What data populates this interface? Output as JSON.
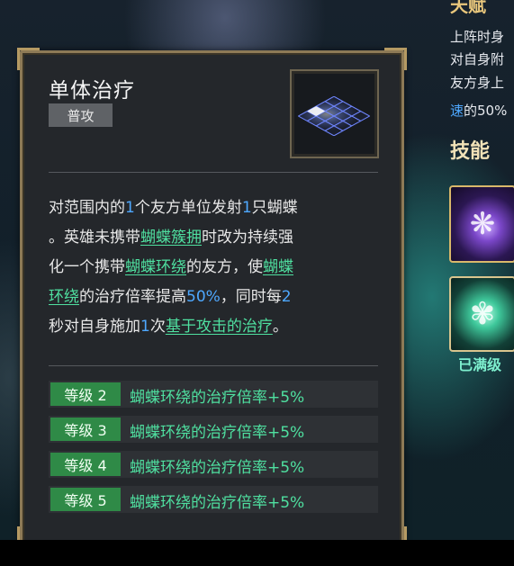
{
  "skill": {
    "name": "单体治疗",
    "tag": "普攻",
    "icon": "grid-tile-icon",
    "description": [
      [
        {
          "t": "对范围内的",
          "c": "text"
        },
        {
          "t": "1",
          "c": "num"
        },
        {
          "t": "个友方单位发射",
          "c": "text"
        },
        {
          "t": "1",
          "c": "num"
        },
        {
          "t": "只蝴蝶",
          "c": "text"
        }
      ],
      [
        {
          "t": "。英雄未携带",
          "c": "text"
        },
        {
          "t": "蝴蝶簇拥",
          "c": "link"
        },
        {
          "t": "时改为持续强",
          "c": "text"
        }
      ],
      [
        {
          "t": "化一个携带",
          "c": "text"
        },
        {
          "t": "蝴蝶环绕",
          "c": "link"
        },
        {
          "t": "的友方，使",
          "c": "text"
        },
        {
          "t": "蝴蝶",
          "c": "link"
        }
      ],
      [
        {
          "t": "环绕",
          "c": "link"
        },
        {
          "t": "的治疗倍率提高",
          "c": "text"
        },
        {
          "t": "50%",
          "c": "num"
        },
        {
          "t": "，同时每",
          "c": "text"
        },
        {
          "t": "2",
          "c": "num"
        }
      ],
      [
        {
          "t": "秒对自身施加",
          "c": "text"
        },
        {
          "t": "1",
          "c": "num"
        },
        {
          "t": "次",
          "c": "text"
        },
        {
          "t": "基于攻击的治疗",
          "c": "link"
        },
        {
          "t": "。",
          "c": "text"
        }
      ]
    ],
    "levels": [
      {
        "label": "等级 2",
        "effect": "蝴蝶环绕的治疗倍率+5%"
      },
      {
        "label": "等级 3",
        "effect": "蝴蝶环绕的治疗倍率+5%"
      },
      {
        "label": "等级 4",
        "effect": "蝴蝶环绕的治疗倍率+5%"
      },
      {
        "label": "等级 5",
        "effect": "蝴蝶环绕的治疗倍率+5%"
      }
    ]
  },
  "right_panel": {
    "header": "天赋",
    "lines": [
      [
        {
          "t": "上阵时身",
          "c": "text"
        }
      ],
      [
        {
          "t": "对自身附",
          "c": "text"
        }
      ],
      [
        {
          "t": "友方身上",
          "c": "text"
        }
      ],
      [
        {
          "t": "速",
          "c": "blue"
        },
        {
          "t": "的50%",
          "c": "text"
        }
      ]
    ],
    "skills_title": "技能",
    "slot1_icon": "butterfly-swirl-icon",
    "slot2_icon": "butterfly-icon",
    "maxed_label": "已满级"
  },
  "colors": {
    "card_bg": "#24272b",
    "gold_border": "#8d7a56",
    "number_blue": "#4ea8ff",
    "link_green": "#4fe0a0",
    "level_badge_green": "#2f8a47"
  }
}
